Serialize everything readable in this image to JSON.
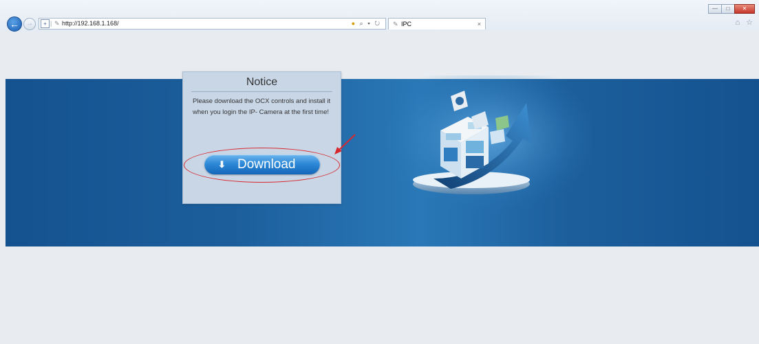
{
  "browser": {
    "address": {
      "url": "http://192.168.1.168/",
      "tools": "⌕ ▾ ↻"
    },
    "tab": {
      "label": "IPC",
      "close": "×"
    },
    "window_controls": {
      "minimize": "—",
      "maximize": "□",
      "close": "✕"
    },
    "right_icons": "⌂ ☆"
  },
  "notice": {
    "title": "Notice",
    "message": "Please download the OCX controls and install it when you login the IP- Camera at the first time!",
    "download_label": "Download"
  },
  "colors": {
    "banner": "#14528f",
    "button": "#2e8ad8",
    "highlight": "#d7282f"
  }
}
